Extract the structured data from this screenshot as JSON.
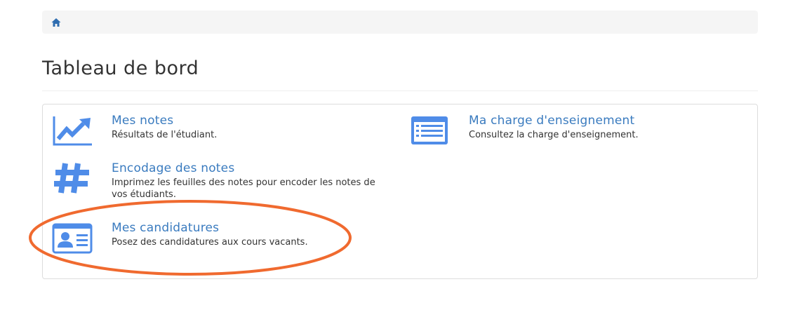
{
  "breadcrumb": {
    "home_icon": "home-icon"
  },
  "page": {
    "title": "Tableau de bord"
  },
  "tiles": [
    {
      "title": "Mes notes",
      "description": "Résultats de l'étudiant.",
      "icon": "chart-line-icon"
    },
    {
      "title": "Encodage des notes",
      "description": "Imprimez les feuilles des notes pour encoder les notes de vos étudiants.",
      "icon": "hashtag-icon"
    },
    {
      "title": "Mes candidatures",
      "description": "Posez des candidatures aux cours vacants.",
      "icon": "id-card-icon"
    },
    {
      "title": "Ma charge d'enseignement",
      "description": "Consultez la charge d'enseignement.",
      "icon": "list-alt-icon"
    }
  ],
  "colors": {
    "link": "#3a7bbf",
    "icon": "#4f8ce8",
    "annotation": "#f06a2f"
  }
}
